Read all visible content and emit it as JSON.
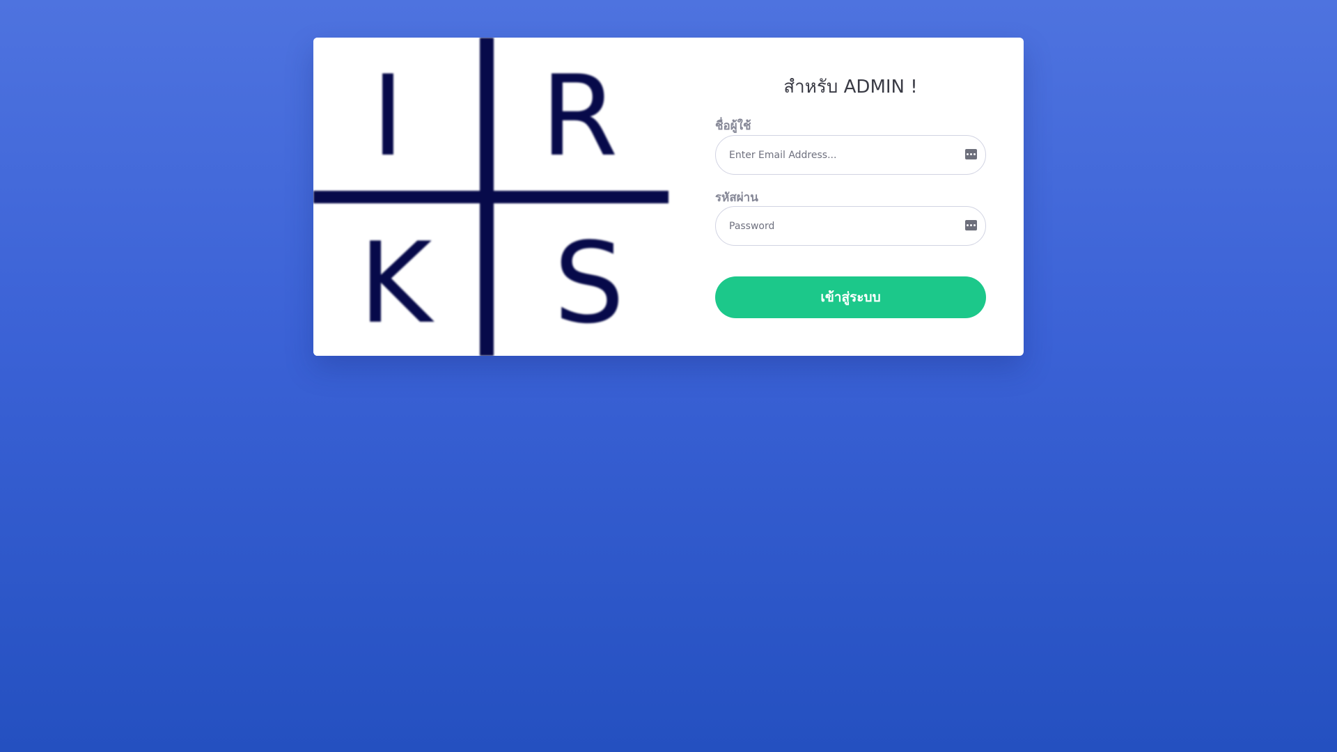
{
  "logo": {
    "letters": [
      "I",
      "R",
      "K",
      "S"
    ],
    "color": "#070a4a"
  },
  "login": {
    "title": "สำหรับ ADMIN !",
    "username_label": "ชื่อผู้ใช้",
    "username_placeholder": "Enter Email Address...",
    "username_value": "",
    "password_label": "รหัสผ่าน",
    "password_placeholder": "Password",
    "password_value": "",
    "submit_label": "เข้าสู่ระบบ"
  },
  "icons": {
    "username_field_icon": "password-key-icon",
    "password_field_icon": "password-key-icon"
  },
  "colors": {
    "background_top": "#4e73df",
    "background_bottom": "#2450c0",
    "button": "#1cc88a",
    "card": "#ffffff"
  }
}
